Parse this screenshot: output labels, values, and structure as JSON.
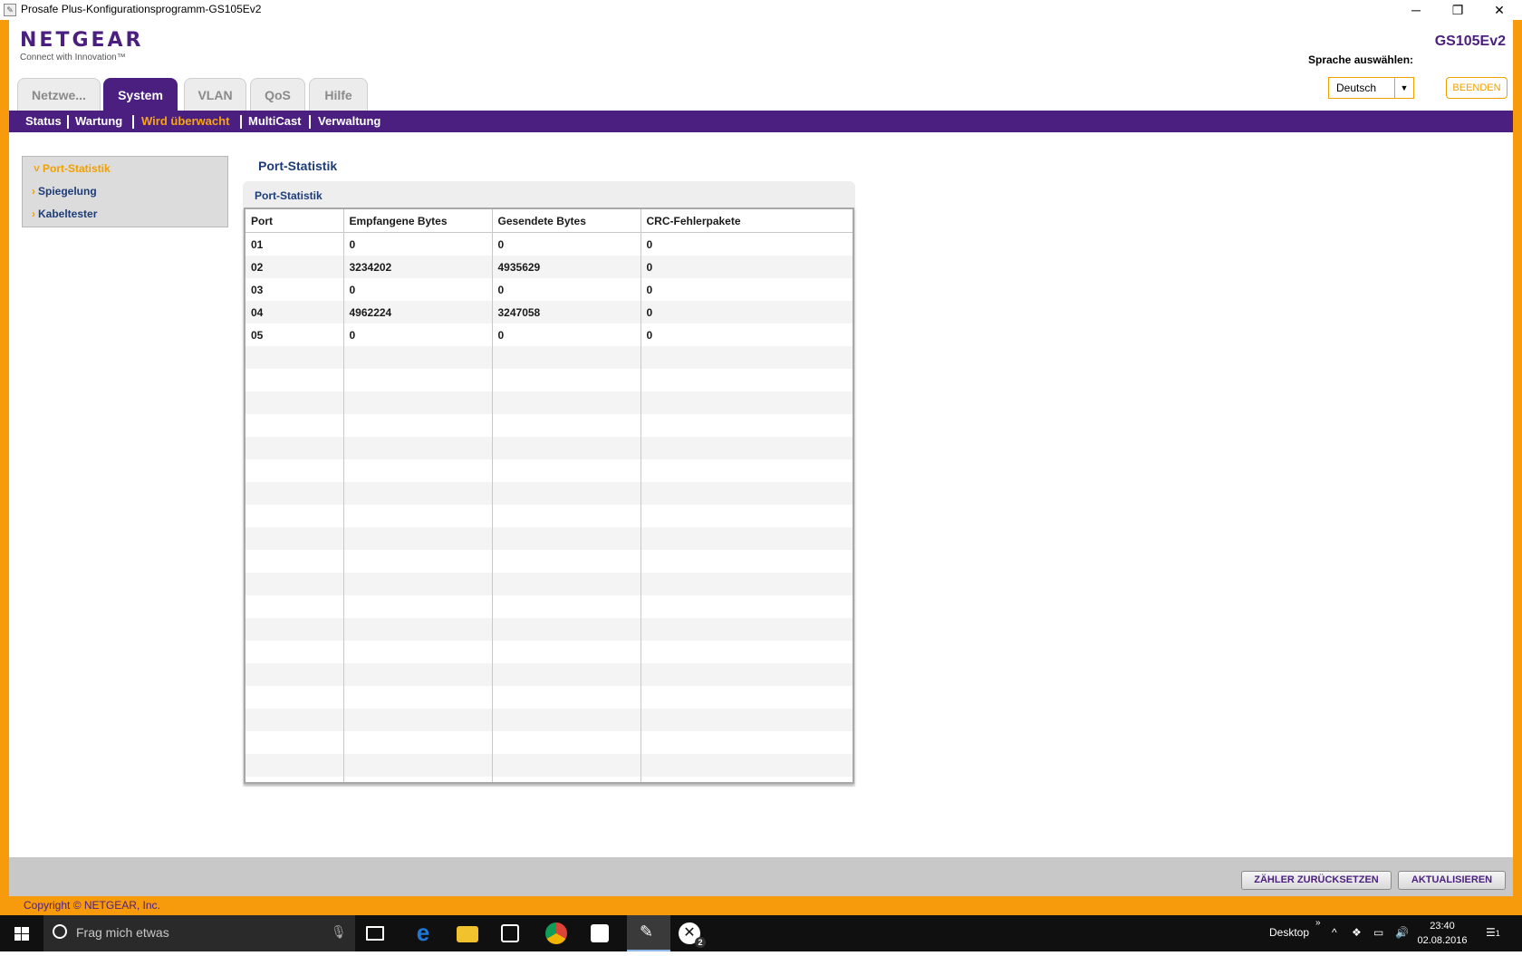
{
  "window": {
    "title": "Prosafe Plus-Konfigurationsprogramm-GS105Ev2",
    "minimize": "─",
    "restore": "❐",
    "close": "✕"
  },
  "header": {
    "brand": "NETGEAR",
    "tagline": "Connect with Innovation™",
    "model": "GS105Ev2",
    "language_label": "Sprache auswählen:",
    "language_value": "Deutsch",
    "quit_label": "BEENDEN"
  },
  "tabs": [
    {
      "label": "Netzwe...",
      "active": false
    },
    {
      "label": "System",
      "active": true
    },
    {
      "label": "VLAN",
      "active": false
    },
    {
      "label": "QoS",
      "active": false
    },
    {
      "label": "Hilfe",
      "active": false
    }
  ],
  "subnav": [
    {
      "label": "Status",
      "active": false
    },
    {
      "label": "Wartung",
      "active": false
    },
    {
      "label": "Wird überwacht",
      "active": true
    },
    {
      "label": "MultiCast",
      "active": false
    },
    {
      "label": "Verwaltung",
      "active": false
    }
  ],
  "leftmenu": [
    {
      "label": "Port-Statistik",
      "caret": "˅",
      "active": true
    },
    {
      "label": "Spiegelung",
      "caret": "›",
      "active": false
    },
    {
      "label": "Kabeltester",
      "caret": "›",
      "active": false
    }
  ],
  "content": {
    "page_title": "Port-Statistik",
    "panel_title": "Port-Statistik",
    "table": {
      "headers": [
        "Port",
        "Empfangene Bytes",
        "Gesendete Bytes",
        "CRC-Fehlerpakete"
      ],
      "rows": [
        [
          "01",
          "0",
          "0",
          "0"
        ],
        [
          "02",
          "3234202",
          "4935629",
          "0"
        ],
        [
          "03",
          "0",
          "0",
          "0"
        ],
        [
          "04",
          "4962224",
          "3247058",
          "0"
        ],
        [
          "05",
          "0",
          "0",
          "0"
        ]
      ]
    }
  },
  "footer": {
    "reset_button": "ZÄHLER ZURÜCKSETZEN",
    "refresh_button": "AKTUALISIEREN",
    "copyright": "Copyright © NETGEAR, Inc."
  },
  "taskbar": {
    "search_placeholder": "Frag mich etwas",
    "desktop_label": "Desktop",
    "time": "23:40",
    "date": "02.08.2016",
    "notification_count": "1",
    "xbox_badge": "2",
    "colors": {
      "edge": "#1e78d7",
      "explorer": "#f2c12e",
      "chrome_red": "#db4437",
      "active_app": "#3a3a3a"
    }
  }
}
